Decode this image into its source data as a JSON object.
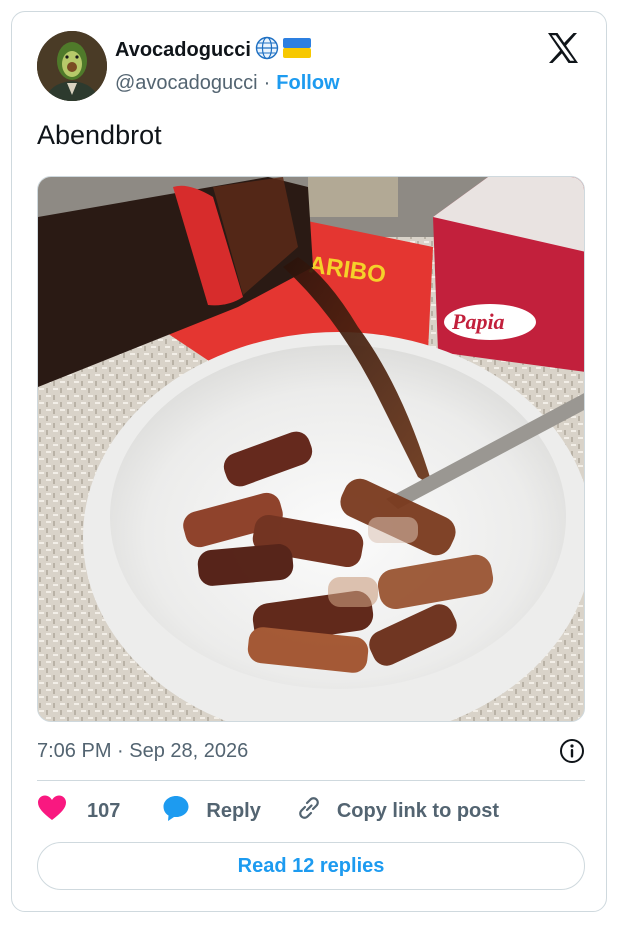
{
  "author": {
    "display_name": "Avocadogucci",
    "handle": "@avocadogucci",
    "separator": "·",
    "follow_label": "Follow",
    "badges": [
      "globe-icon",
      "ukraine-flag-icon"
    ]
  },
  "platform_icon": "x-logo-icon",
  "tweet": {
    "text": "Abendbrot",
    "media_description_icon": "photo"
  },
  "meta": {
    "timestamp": "7:06 PM · Sep 28, 2026",
    "info_icon": "info-icon"
  },
  "actions": {
    "like_count": "107",
    "reply_label": "Reply",
    "copy_link_label": "Copy link to post"
  },
  "read_replies_label": "Read 12 replies",
  "colors": {
    "accent": "#1d9bf0",
    "like": "#f91880",
    "text_secondary": "#536471",
    "border": "#cfd9de"
  }
}
